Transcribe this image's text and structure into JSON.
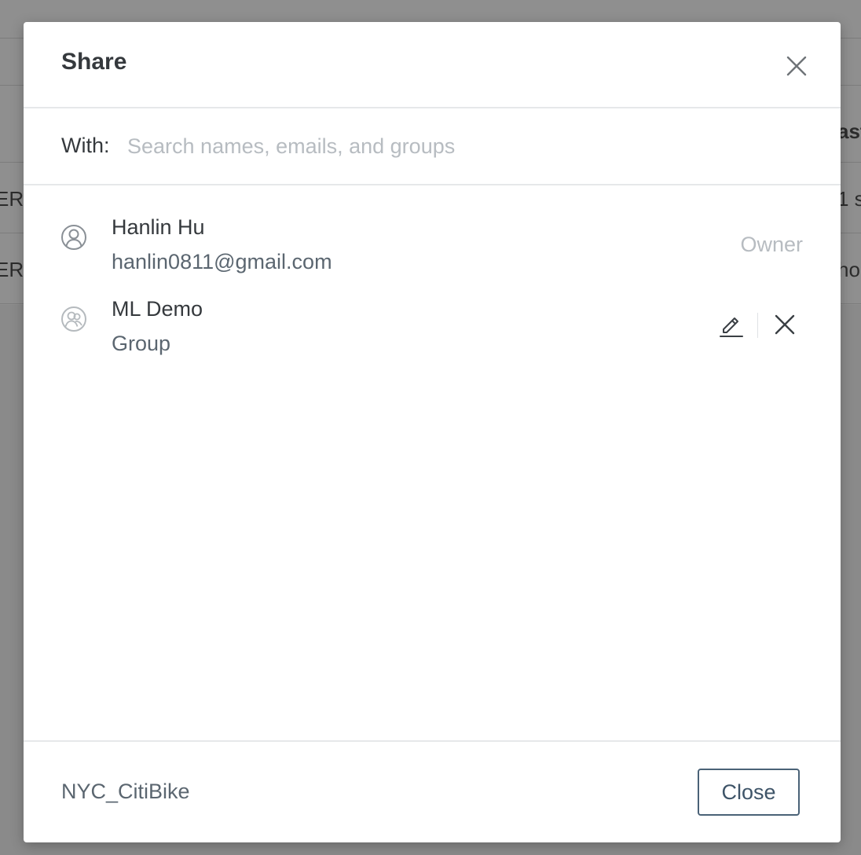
{
  "background": {
    "col_header_fragment": "ast",
    "row1_left": "ER",
    "row1_right": "1 s",
    "row2_left": "ER",
    "row2_right": "ho"
  },
  "dialog": {
    "title": "Share",
    "with_label": "With:",
    "search_placeholder": "Search names, emails, and groups",
    "members": [
      {
        "name": "Hanlin Hu",
        "subtitle": "hanlin0811@gmail.com",
        "role": "Owner",
        "icon": "user-icon"
      },
      {
        "name": "ML Demo",
        "subtitle": "Group",
        "icon": "group-icon"
      }
    ],
    "footer_name": "NYC_CitiBike",
    "close_label": "Close"
  }
}
